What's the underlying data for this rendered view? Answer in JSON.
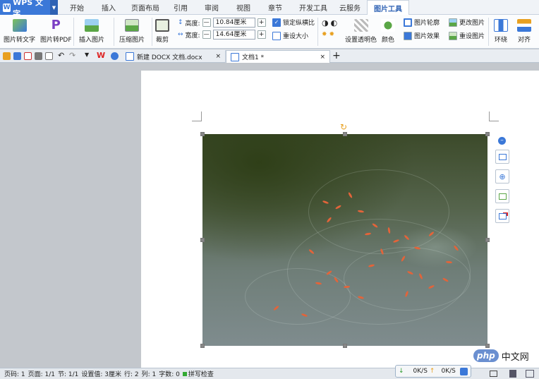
{
  "app": {
    "brand": "WPS 文字",
    "brand_glyph": "W",
    "accent": "#3b78d8"
  },
  "menu": {
    "tabs": [
      "开始",
      "插入",
      "页面布局",
      "引用",
      "审阅",
      "视图",
      "章节",
      "开发工具",
      "云服务",
      "图片工具"
    ],
    "active": "图片工具"
  },
  "ribbon": {
    "pic_to_text": "图片转文字",
    "pic_to_pdf": "图片转PDF",
    "insert_pic": "插入图片",
    "compress": "压缩图片",
    "crop": "裁剪",
    "height_label": "高度:",
    "height_value": "10.84厘米",
    "width_label": "宽度:",
    "width_value": "14.64厘米",
    "lock_ratio": "锁定纵横比",
    "reset_size": "重设大小",
    "set_transparent": "设置透明色",
    "color": "颜色",
    "outline": "图片轮廓",
    "effect": "图片效果",
    "change_pic": "更改图片",
    "reset_pic": "重设图片",
    "wrap": "环绕",
    "align": "对齐",
    "minus": "—",
    "plus": "+"
  },
  "doc_tabs": [
    {
      "label": "新建 DOCX 文档.docx",
      "close": "×"
    },
    {
      "label": "文档1 *",
      "close": "×"
    }
  ],
  "new_tab": "+",
  "status": {
    "page_code": "页码: 1",
    "page": "页面: 1/1",
    "section": "节: 1/1",
    "setting": "设置值: 3厘米",
    "row": "行: 2",
    "col": "列: 1",
    "words": "字数: 0",
    "spell": "拼写检查"
  },
  "network": {
    "down": "0K/S",
    "up": "0K/S"
  },
  "watermark": {
    "logo": "php",
    "text": "中文网"
  }
}
